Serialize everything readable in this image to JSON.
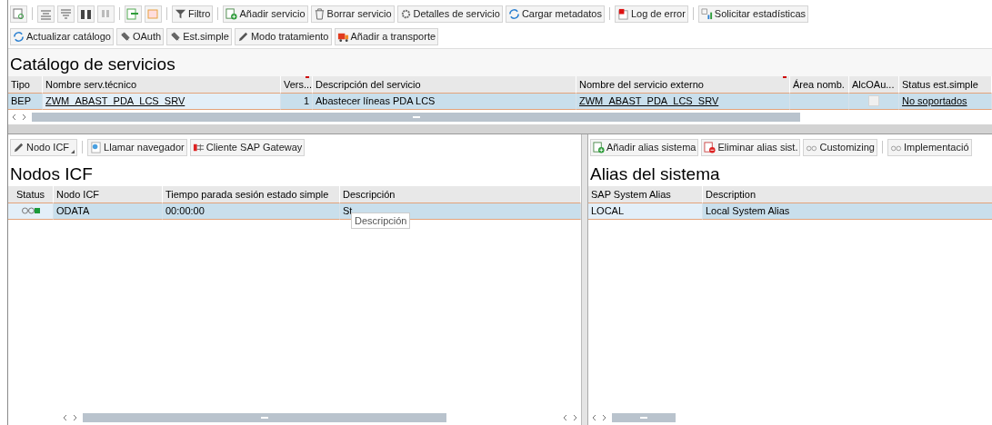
{
  "toolbar_main": {
    "buttons": [
      "Filtro",
      "Añadir servicio",
      "Borrar servicio",
      "Detalles de servicio",
      "Cargar metadatos",
      "Log de error",
      "Solicitar estadísticas"
    ]
  },
  "toolbar_secondary": {
    "buttons": [
      "Actualizar catálogo",
      "OAuth",
      "Est.simple",
      "Modo tratamiento",
      "Añadir a transporte"
    ]
  },
  "catalog": {
    "title": "Catálogo de servicios",
    "columns": [
      "Tipo",
      "Nombre serv.técnico",
      "Vers...",
      "Descripción del servicio",
      "Nombre del servicio externo",
      "Área nomb.",
      "AlcOAu...",
      "Status est.simple"
    ],
    "rows": [
      {
        "tipo": "BEP",
        "technical_name": "ZWM_ABAST_PDA_LCS_SRV",
        "version": "1",
        "description": "Abastecer líneas PDA LCS",
        "external_name": "ZWM_ABAST_PDA_LCS_SRV",
        "oauth_checked": false,
        "status": "No soportados",
        "selected": true
      }
    ]
  },
  "icf_panel": {
    "toolbar": [
      {
        "label": "Nodo ICF",
        "dropdown": true
      },
      {
        "label": "Llamar navegador",
        "dropdown": false
      },
      {
        "label": "Cliente SAP Gateway",
        "dropdown": false
      }
    ],
    "title": "Nodos ICF",
    "columns": [
      "Status",
      "Nodo ICF",
      "Tiempo parada sesión estado simple",
      "Descripción"
    ],
    "rows": [
      {
        "node": "ODATA",
        "time": "00:00:00",
        "description": "St",
        "selected": true
      }
    ],
    "tooltip": "Descripción"
  },
  "alias_panel": {
    "toolbar": [
      "Añadir alias sistema",
      "Eliminar alias sist.",
      "Customizing",
      "Implementació"
    ],
    "title": "Alias del sistema",
    "columns": [
      "SAP System Alias",
      "Description"
    ],
    "rows": [
      {
        "alias": "LOCAL",
        "description": "Local System Alias",
        "selected": true
      }
    ]
  }
}
